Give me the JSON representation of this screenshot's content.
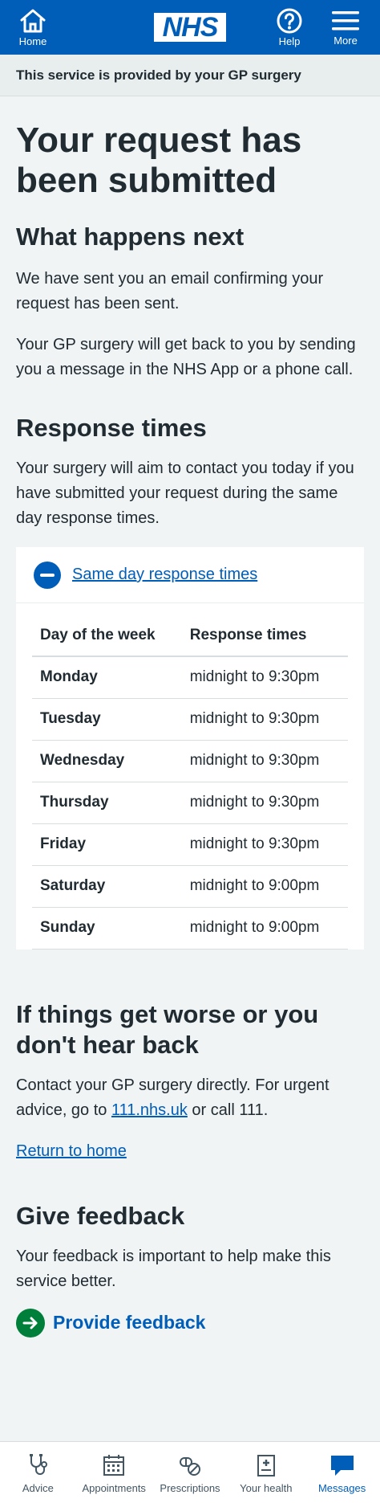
{
  "header": {
    "home_label": "Home",
    "logo_text": "NHS",
    "help_label": "Help",
    "more_label": "More"
  },
  "provided_by": "This service is provided by your GP surgery",
  "title": "Your request has been submitted",
  "next": {
    "heading": "What happens next",
    "p1": "We have sent you an email confirming your request has been sent.",
    "p2": "Your GP surgery will get back to you by sending you a message in the NHS App or a phone call."
  },
  "response": {
    "heading": "Response times",
    "intro": "Your surgery will aim to contact you today if you have submitted your request during the same day response times.",
    "details_label": "Same day response times",
    "table_headers": [
      "Day of the week",
      "Response times"
    ],
    "rows": [
      {
        "day": "Monday",
        "time": "midnight to 9:30pm"
      },
      {
        "day": "Tuesday",
        "time": "midnight to 9:30pm"
      },
      {
        "day": "Wednesday",
        "time": "midnight to 9:30pm"
      },
      {
        "day": "Thursday",
        "time": "midnight to 9:30pm"
      },
      {
        "day": "Friday",
        "time": "midnight to 9:30pm"
      },
      {
        "day": "Saturday",
        "time": "midnight to 9:00pm"
      },
      {
        "day": "Sunday",
        "time": "midnight to 9:00pm"
      }
    ]
  },
  "worse": {
    "heading": "If things get worse or you don't hear back",
    "text_before": "Contact your GP surgery directly. For urgent advice, go to ",
    "link": "111.nhs.uk",
    "text_after": " or call 111."
  },
  "return_link": "Return to home",
  "feedback": {
    "heading": "Give feedback",
    "text": "Your feedback is important to help make this service better.",
    "link": "Provide feedback"
  },
  "bottom_nav": [
    {
      "label": "Advice",
      "icon": "stethoscope-icon"
    },
    {
      "label": "Appointments",
      "icon": "calendar-icon"
    },
    {
      "label": "Prescriptions",
      "icon": "pills-icon"
    },
    {
      "label": "Your health",
      "icon": "health-record-icon"
    },
    {
      "label": "Messages",
      "icon": "messages-icon"
    }
  ],
  "colors": {
    "nhs_blue": "#005eb8",
    "green": "#007f3b",
    "background": "#f0f4f5"
  }
}
